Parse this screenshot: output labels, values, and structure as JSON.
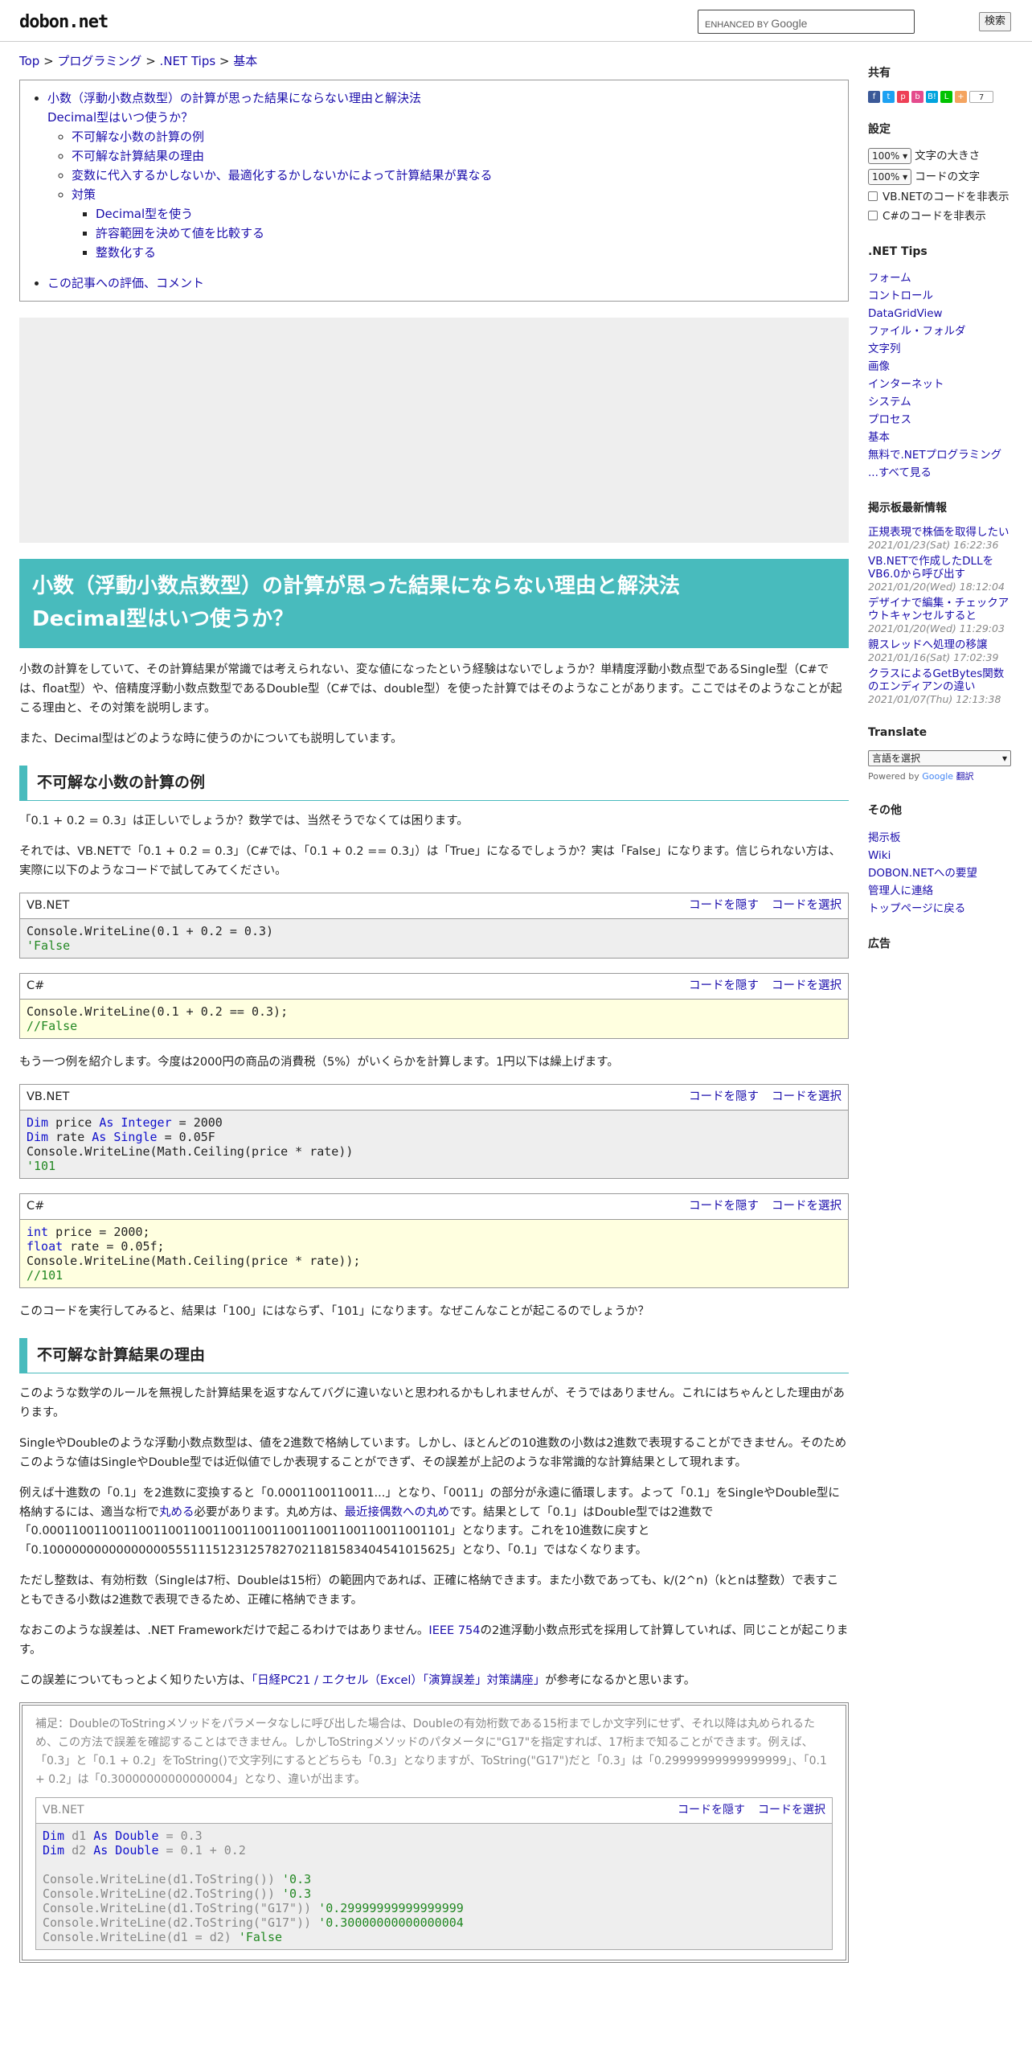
{
  "header": {
    "logo": "dobon.net",
    "search_enhanced": "ENHANCED BY",
    "search_google": "Google",
    "search_button": "検索"
  },
  "breadcrumb": [
    "Top",
    "プログラミング",
    ".NET Tips",
    "基本"
  ],
  "toc": {
    "main_title": "小数（浮動小数点数型）の計算が思った結果にならない理由と解決法",
    "main_title2": "Decimal型はいつ使うか？",
    "items": [
      "不可解な小数の計算の例",
      "不可解な計算結果の理由",
      "変数に代入するかしないか、最適化するかしないかによって計算結果が異なる",
      "対策"
    ],
    "subitems": [
      "Decimal型を使う",
      "許容範囲を決めて値を比較する",
      "整数化する"
    ],
    "comment": "この記事への評価、コメント"
  },
  "article": {
    "title": "小数（浮動小数点数型）の計算が思った結果にならない理由と解決法",
    "title2": "Decimal型はいつ使うか？",
    "p1": "小数の計算をしていて、その計算結果が常識では考えられない、変な値になったという経験はないでしょうか？単精度浮動小数点型であるSingle型（C#では、float型）や、倍精度浮動小数点数型であるDouble型（C#では、double型）を使った計算ではそのようなことがあります。ここではそのようなことが起こる理由と、その対策を説明します。",
    "p2": "また、Decimal型はどのような時に使うのかについても説明しています。",
    "h_example": "不可解な小数の計算の例",
    "p3": "「0.1 + 0.2 = 0.3」は正しいでしょうか？数学では、当然そうでなくては困ります。",
    "p4": "それでは、VB.NETで「0.1 + 0.2 = 0.3」（C#では、「0.1 + 0.2 == 0.3」）は「True」になるでしょうか？実は「False」になります。信じられない方は、実際に以下のようなコードで試してみてください。",
    "p5": "もう一つ例を紹介します。今度は2000円の商品の消費税（5%）がいくらかを計算します。1円以下は繰上げます。",
    "p6": "このコードを実行してみると、結果は「100」にはならず、「101」になります。なぜこんなことが起こるのでしょうか？",
    "h_reason": "不可解な計算結果の理由",
    "p7": "このような数学のルールを無視した計算結果を返すなんてバグに違いないと思われるかもしれませんが、そうではありません。これにはちゃんとした理由があります。",
    "p8": "SingleやDoubleのような浮動小数点数型は、値を2進数で格納しています。しかし、ほとんどの10進数の小数は2進数で表現することができません。そのためこのような値はSingleやDouble型では近似値でしか表現することができず、その誤差が上記のような非常識的な計算結果として現れます。",
    "p9a": "例えば十進数の「0.1」を2進数に変換すると「0.0001100110011...」となり、「0011」の部分が永遠に循環します。よって「0.1」をSingleやDouble型に格納するには、適当な桁で",
    "p9_link1": "丸める",
    "p9b": "必要があります。丸め方は、",
    "p9_link2": "最近接偶数への丸め",
    "p9c": "です。結果として「0.1」はDouble型では2進数で「0.0001100110011001100110011001100110011001100110011001101」となります。これを10進数に戻すと「0.1000000000000000055511151231257827021181583404541015625」となり、「0.1」ではなくなります。",
    "p10": "ただし整数は、有効桁数（Singleは7桁、Doubleは15桁）の範囲内であれば、正確に格納できます。また小数であっても、k/(2^n)（kとnは整数）で表すこともできる小数は2進数で表現できるため、正確に格納できます。",
    "p11a": "なおこのような誤差は、.NET Frameworkだけで起こるわけではありません。",
    "p11_link": "IEEE 754",
    "p11b": "の2進浮動小数点形式を採用して計算していれば、同じことが起こります。",
    "p12a": "この誤差についてもっとよく知りたい方は、",
    "p12_link1": "「日経PC21 / エクセル（Excel）「演算誤差」対策講座」",
    "p12b": "が参考になるかと思います。",
    "note": "補足：DoubleのToStringメソッドをパラメータなしに呼び出した場合は、Doubleの有効桁数である15桁までしか文字列にせず、それ以降は丸められるため、この方法で誤差を確認することはできません。しかしToStringメソッドのパタメータに\"G17\"を指定すれば、17桁まで知ることができます。例えば、「0.3」と「0.1 + 0.2」をToString()で文字列にするとどちらも「0.3」となりますが、ToString(\"G17\")だと「0.3」は「0.29999999999999999」、「0.1 + 0.2」は「0.30000000000000004」となり、違いが出ます。"
  },
  "code_ui": {
    "vb_label": "VB.NET",
    "cs_label": "C#",
    "hide": "コードを隠す",
    "select": "コードを選択"
  },
  "sidebar": {
    "share_title": "共有",
    "share_count": "7",
    "settings_title": "設定",
    "font_size_value": "100%",
    "font_size_label": "文字の大きさ",
    "code_size_value": "100%",
    "code_size_label": "コードの文字",
    "hide_vb": "VB.NETのコードを非表示",
    "hide_cs": "C#のコードを非表示",
    "tips_title": ".NET Tips",
    "tips": [
      "フォーム",
      "コントロール",
      "DataGridView",
      "ファイル・フォルダ",
      "文字列",
      "画像",
      "インターネット",
      "システム",
      "プロセス",
      "基本",
      "無料で.NETプログラミング",
      "...すべて見る"
    ],
    "bbs_title": "掲示板最新情報",
    "bbs": [
      {
        "title": "正規表現で株価を取得したい",
        "date": "2021/01/23(Sat) 16:22:36"
      },
      {
        "title": "VB.NETで作成したDLLをVB6.0から呼び出す",
        "date": "2021/01/20(Wed) 18:12:04"
      },
      {
        "title": "デザイナで編集・チェックアウトキャンセルすると",
        "date": "2021/01/20(Wed) 11:29:03"
      },
      {
        "title": "親スレッドへ処理の移譲",
        "date": "2021/01/16(Sat) 17:02:39"
      },
      {
        "title": "クラスによるGetBytes関数のエンディアンの違い",
        "date": "2021/01/07(Thu) 12:13:38"
      }
    ],
    "translate_title": "Translate",
    "lang_select": "言語を選択",
    "powered_by": "Powered by",
    "powered_google": "Google",
    "powered_translate": "翻訳",
    "other_title": "その他",
    "other": [
      "掲示板",
      "Wiki",
      "DOBON.NETへの要望",
      "管理人に連絡",
      "トップページに戻る"
    ],
    "ad_title": "広告"
  }
}
